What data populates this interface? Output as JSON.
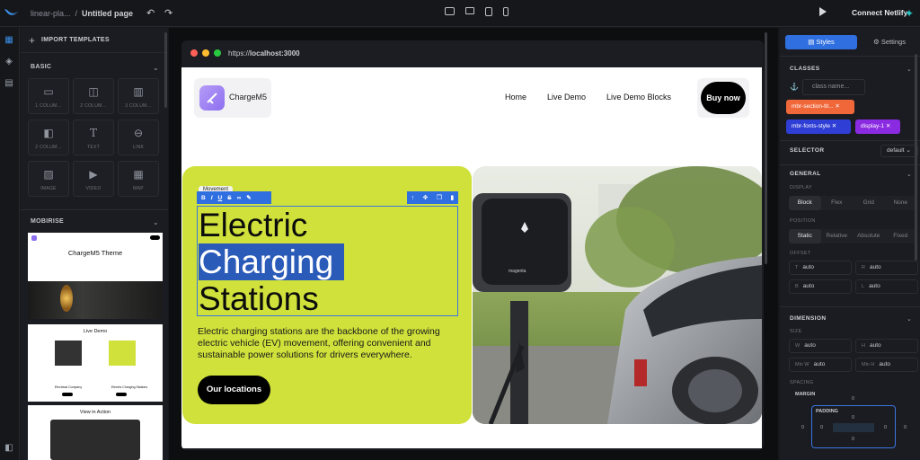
{
  "topbar": {
    "project": "linear-pla...",
    "separator": "/",
    "page": "Untitled page",
    "connect_label": "Connect Netlify"
  },
  "left_panel": {
    "import_label": "IMPORT TEMPLATES",
    "basic_title": "BASIC",
    "blocks": [
      {
        "label": "1 COLUM...",
        "icon": "single-column-icon"
      },
      {
        "label": "2 COLUM...",
        "icon": "two-column-icon"
      },
      {
        "label": "3 COLUM...",
        "icon": "three-column-icon"
      },
      {
        "label": "2 COLUM...",
        "icon": "two-column-alt-icon"
      },
      {
        "label": "TEXT",
        "icon": "text-icon"
      },
      {
        "label": "LINK",
        "icon": "link-icon"
      },
      {
        "label": "IMAGE",
        "icon": "image-icon"
      },
      {
        "label": "VIDEO",
        "icon": "video-icon"
      },
      {
        "label": "MAP",
        "icon": "map-icon"
      }
    ],
    "mobirise_title": "MOBIRISE",
    "templates": [
      {
        "title": "ChargeM5 Theme"
      },
      {
        "title": "Live Demo",
        "left_caption": "Electrical Company",
        "right_caption": "Electric Charging Stations"
      },
      {
        "title": "View in Action"
      }
    ]
  },
  "browser": {
    "url_prefix": "https://",
    "url_host": "localhost:3000"
  },
  "site": {
    "brand": "ChargeM5",
    "menu": [
      "Home",
      "Live Demo",
      "Live Demo Blocks"
    ],
    "buy_label": "Buy now",
    "tag_label": "Movement",
    "title_line1": "Electric",
    "title_line2": "Charging",
    "title_line3": "Stations",
    "description": "Electric charging stations are the backbone of the growing electric vehicle (EV) movement, offering convenient and sustainable power solutions for drivers everywhere.",
    "cta_label": "Our locations",
    "charger_brand": "magenta"
  },
  "right_panel": {
    "tab_styles": "Styles",
    "tab_settings": "Settings",
    "classes_title": "CLASSES",
    "class_placeholder": "class name...",
    "chips": [
      "mbr-section-tit...",
      "mbr-fonts-style",
      "display-1"
    ],
    "selector_title": "SELECTOR",
    "selector_value": "default",
    "general_title": "GENERAL",
    "display_label": "DISPLAY",
    "display_options": [
      "Block",
      "Flex",
      "Grid",
      "None"
    ],
    "position_label": "POSITION",
    "position_options": [
      "Static",
      "Relative",
      "Absolute",
      "Fixed"
    ],
    "offset_label": "OFFSET",
    "offset_fields": [
      {
        "key": "T",
        "value": "auto"
      },
      {
        "key": "R",
        "value": "auto"
      },
      {
        "key": "B",
        "value": "auto"
      },
      {
        "key": "L",
        "value": "auto"
      }
    ],
    "dimension_title": "DIMENSION",
    "size_label": "SIZE",
    "size_fields": [
      {
        "key": "W",
        "value": "auto"
      },
      {
        "key": "H",
        "value": "auto"
      },
      {
        "key": "Min W",
        "value": "auto"
      },
      {
        "key": "Min H",
        "value": "auto"
      }
    ],
    "spacing_label": "SPACING",
    "margin_label": "MARGIN",
    "padding_label": "PADDING",
    "zero": "0"
  },
  "colors": {
    "accent": "#2f6fe0",
    "hero_bg": "#cfe13a",
    "chip_orange": "#f0673a",
    "chip_blue": "#2f3fd6",
    "chip_purple": "#8a2be2"
  }
}
